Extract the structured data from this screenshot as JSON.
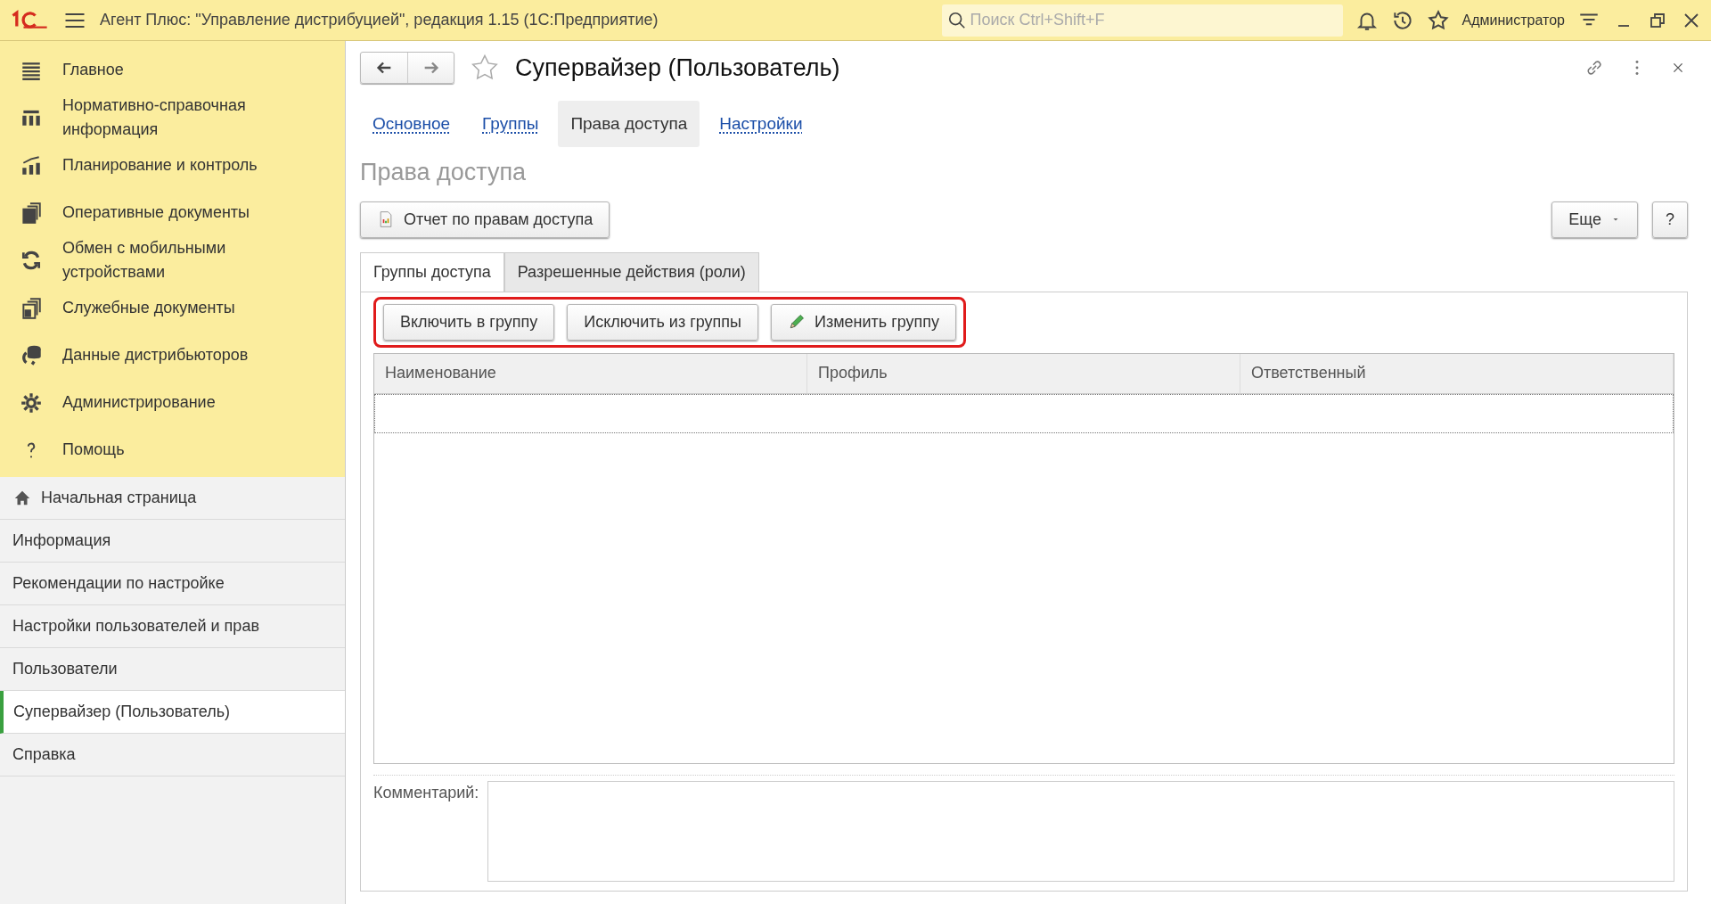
{
  "window": {
    "title": "Агент Плюс: \"Управление дистрибуцией\", редакция 1.15  (1С:Предприятие)",
    "search": {
      "placeholder": "Поиск Ctrl+Shift+F"
    },
    "user": "Администратор"
  },
  "sidebar": {
    "sections": [
      {
        "label": "Главное"
      },
      {
        "label": "Нормативно-справочная информация"
      },
      {
        "label": "Планирование и контроль"
      },
      {
        "label": "Оперативные документы"
      },
      {
        "label": "Обмен с мобильными устройствами"
      },
      {
        "label": "Служебные документы"
      },
      {
        "label": "Данные дистрибьюторов"
      },
      {
        "label": "Администрирование"
      },
      {
        "label": "Помощь"
      }
    ],
    "open_windows": [
      {
        "label": "Начальная страница",
        "kind": "home",
        "selected": false
      },
      {
        "label": "Информация",
        "kind": "page",
        "selected": false
      },
      {
        "label": "Рекомендации по настройке",
        "kind": "page",
        "selected": false
      },
      {
        "label": "Настройки пользователей и прав",
        "kind": "page",
        "selected": false
      },
      {
        "label": "Пользователи",
        "kind": "page",
        "selected": false
      },
      {
        "label": "Супервайзер (Пользователь)",
        "kind": "page",
        "selected": true
      },
      {
        "label": "Справка",
        "kind": "page",
        "selected": false
      }
    ]
  },
  "form": {
    "title": "Супервайзер (Пользователь)",
    "favorite": false,
    "tabs": [
      {
        "label": "Основное",
        "selected": false
      },
      {
        "label": "Группы",
        "selected": false
      },
      {
        "label": "Права доступа",
        "selected": true
      },
      {
        "label": "Настройки",
        "selected": false
      }
    ],
    "heading": "Права доступа",
    "report_button": "Отчет по правам доступа",
    "more_button": "Еще",
    "help_button": "?",
    "inner_tabs": [
      {
        "label": "Группы доступа",
        "selected": true
      },
      {
        "label": "Разрешенные действия (роли)",
        "selected": false
      }
    ],
    "commands": {
      "highlighted": true,
      "buttons": [
        {
          "label": "Включить в группу",
          "kind": "plain"
        },
        {
          "label": "Исключить из группы",
          "kind": "plain"
        },
        {
          "label": "Изменить группу",
          "kind": "edit"
        }
      ]
    },
    "table": {
      "columns": [
        "Наименование",
        "Профиль",
        "Ответственный"
      ]
    },
    "comment": {
      "label": "Комментарий:"
    }
  }
}
